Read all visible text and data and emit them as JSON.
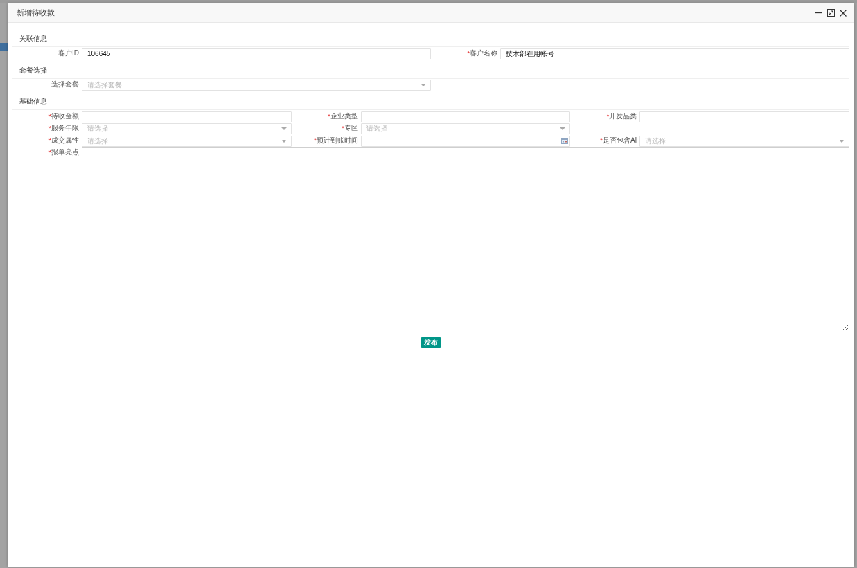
{
  "dialog": {
    "title": "新增待收款",
    "window_controls": [
      {
        "kind": "minimize"
      },
      {
        "kind": "maximize"
      },
      {
        "kind": "close"
      }
    ]
  },
  "sections": [
    {
      "title": "关联信息",
      "kind": "halves",
      "rows": [
        [
          {
            "kind": "text",
            "label": "客户ID",
            "value": "106645"
          },
          {
            "kind": "text",
            "label": "客户名称",
            "required_mark": "*",
            "value": "技术部在用帐号"
          }
        ]
      ]
    },
    {
      "title": "套餐选择",
      "kind": "halves",
      "rows": [
        [
          {
            "kind": "select",
            "label": "选择套餐",
            "placeholder": "请选择套餐"
          }
        ]
      ]
    },
    {
      "title": "基础信息",
      "kind": "thirds",
      "rows": [
        [
          {
            "kind": "text",
            "label": "待收金额",
            "required_mark": "*"
          },
          {
            "kind": "text",
            "label": "企业类型",
            "required_mark": "*"
          },
          {
            "kind": "text",
            "label": "开发品类",
            "required_mark": "*"
          }
        ],
        [
          {
            "kind": "select",
            "label": "服务年限",
            "required_mark": "*",
            "placeholder": "请选择"
          },
          {
            "kind": "select",
            "label": "专区",
            "required_mark": "*",
            "placeholder": "请选择"
          }
        ],
        [
          {
            "kind": "select",
            "label": "成交属性",
            "required_mark": "*",
            "placeholder": "请选择"
          },
          {
            "kind": "date",
            "label": "预计到账时间",
            "required_mark": "*"
          },
          {
            "kind": "select",
            "label": "是否包含AI",
            "required_mark": "*",
            "placeholder": "请选择"
          }
        ],
        [
          {
            "kind": "textarea",
            "label": "报单亮点",
            "required_mark": "*"
          }
        ]
      ]
    }
  ],
  "submit_button": {
    "label": "发布"
  }
}
